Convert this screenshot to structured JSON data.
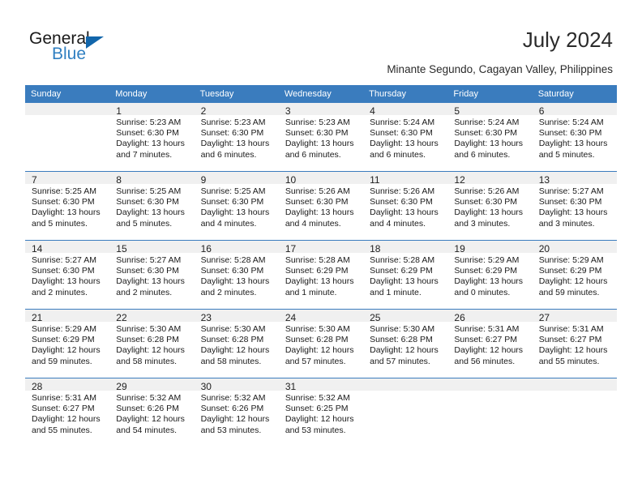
{
  "brand": {
    "name_primary": "General",
    "name_secondary": "Blue",
    "triangle_icon": "triangle-icon",
    "accent_color": "#1266ab",
    "secondary_color": "#2f7fc1"
  },
  "header": {
    "title": "July 2024",
    "subtitle": "Minante Segundo, Cagayan Valley, Philippines"
  },
  "table": {
    "header_bg": "#3a7cbe",
    "daynum_bg": "#f0f0f0",
    "columns": [
      "Sunday",
      "Monday",
      "Tuesday",
      "Wednesday",
      "Thursday",
      "Friday",
      "Saturday"
    ]
  },
  "weeks": [
    [
      {
        "day": "",
        "lines": []
      },
      {
        "day": "1",
        "lines": [
          "Sunrise: 5:23 AM",
          "Sunset: 6:30 PM",
          "Daylight: 13 hours",
          "and 7 minutes."
        ]
      },
      {
        "day": "2",
        "lines": [
          "Sunrise: 5:23 AM",
          "Sunset: 6:30 PM",
          "Daylight: 13 hours",
          "and 6 minutes."
        ]
      },
      {
        "day": "3",
        "lines": [
          "Sunrise: 5:23 AM",
          "Sunset: 6:30 PM",
          "Daylight: 13 hours",
          "and 6 minutes."
        ]
      },
      {
        "day": "4",
        "lines": [
          "Sunrise: 5:24 AM",
          "Sunset: 6:30 PM",
          "Daylight: 13 hours",
          "and 6 minutes."
        ]
      },
      {
        "day": "5",
        "lines": [
          "Sunrise: 5:24 AM",
          "Sunset: 6:30 PM",
          "Daylight: 13 hours",
          "and 6 minutes."
        ]
      },
      {
        "day": "6",
        "lines": [
          "Sunrise: 5:24 AM",
          "Sunset: 6:30 PM",
          "Daylight: 13 hours",
          "and 5 minutes."
        ]
      }
    ],
    [
      {
        "day": "7",
        "lines": [
          "Sunrise: 5:25 AM",
          "Sunset: 6:30 PM",
          "Daylight: 13 hours",
          "and 5 minutes."
        ]
      },
      {
        "day": "8",
        "lines": [
          "Sunrise: 5:25 AM",
          "Sunset: 6:30 PM",
          "Daylight: 13 hours",
          "and 5 minutes."
        ]
      },
      {
        "day": "9",
        "lines": [
          "Sunrise: 5:25 AM",
          "Sunset: 6:30 PM",
          "Daylight: 13 hours",
          "and 4 minutes."
        ]
      },
      {
        "day": "10",
        "lines": [
          "Sunrise: 5:26 AM",
          "Sunset: 6:30 PM",
          "Daylight: 13 hours",
          "and 4 minutes."
        ]
      },
      {
        "day": "11",
        "lines": [
          "Sunrise: 5:26 AM",
          "Sunset: 6:30 PM",
          "Daylight: 13 hours",
          "and 4 minutes."
        ]
      },
      {
        "day": "12",
        "lines": [
          "Sunrise: 5:26 AM",
          "Sunset: 6:30 PM",
          "Daylight: 13 hours",
          "and 3 minutes."
        ]
      },
      {
        "day": "13",
        "lines": [
          "Sunrise: 5:27 AM",
          "Sunset: 6:30 PM",
          "Daylight: 13 hours",
          "and 3 minutes."
        ]
      }
    ],
    [
      {
        "day": "14",
        "lines": [
          "Sunrise: 5:27 AM",
          "Sunset: 6:30 PM",
          "Daylight: 13 hours",
          "and 2 minutes."
        ]
      },
      {
        "day": "15",
        "lines": [
          "Sunrise: 5:27 AM",
          "Sunset: 6:30 PM",
          "Daylight: 13 hours",
          "and 2 minutes."
        ]
      },
      {
        "day": "16",
        "lines": [
          "Sunrise: 5:28 AM",
          "Sunset: 6:30 PM",
          "Daylight: 13 hours",
          "and 2 minutes."
        ]
      },
      {
        "day": "17",
        "lines": [
          "Sunrise: 5:28 AM",
          "Sunset: 6:29 PM",
          "Daylight: 13 hours",
          "and 1 minute."
        ]
      },
      {
        "day": "18",
        "lines": [
          "Sunrise: 5:28 AM",
          "Sunset: 6:29 PM",
          "Daylight: 13 hours",
          "and 1 minute."
        ]
      },
      {
        "day": "19",
        "lines": [
          "Sunrise: 5:29 AM",
          "Sunset: 6:29 PM",
          "Daylight: 13 hours",
          "and 0 minutes."
        ]
      },
      {
        "day": "20",
        "lines": [
          "Sunrise: 5:29 AM",
          "Sunset: 6:29 PM",
          "Daylight: 12 hours",
          "and 59 minutes."
        ]
      }
    ],
    [
      {
        "day": "21",
        "lines": [
          "Sunrise: 5:29 AM",
          "Sunset: 6:29 PM",
          "Daylight: 12 hours",
          "and 59 minutes."
        ]
      },
      {
        "day": "22",
        "lines": [
          "Sunrise: 5:30 AM",
          "Sunset: 6:28 PM",
          "Daylight: 12 hours",
          "and 58 minutes."
        ]
      },
      {
        "day": "23",
        "lines": [
          "Sunrise: 5:30 AM",
          "Sunset: 6:28 PM",
          "Daylight: 12 hours",
          "and 58 minutes."
        ]
      },
      {
        "day": "24",
        "lines": [
          "Sunrise: 5:30 AM",
          "Sunset: 6:28 PM",
          "Daylight: 12 hours",
          "and 57 minutes."
        ]
      },
      {
        "day": "25",
        "lines": [
          "Sunrise: 5:30 AM",
          "Sunset: 6:28 PM",
          "Daylight: 12 hours",
          "and 57 minutes."
        ]
      },
      {
        "day": "26",
        "lines": [
          "Sunrise: 5:31 AM",
          "Sunset: 6:27 PM",
          "Daylight: 12 hours",
          "and 56 minutes."
        ]
      },
      {
        "day": "27",
        "lines": [
          "Sunrise: 5:31 AM",
          "Sunset: 6:27 PM",
          "Daylight: 12 hours",
          "and 55 minutes."
        ]
      }
    ],
    [
      {
        "day": "28",
        "lines": [
          "Sunrise: 5:31 AM",
          "Sunset: 6:27 PM",
          "Daylight: 12 hours",
          "and 55 minutes."
        ]
      },
      {
        "day": "29",
        "lines": [
          "Sunrise: 5:32 AM",
          "Sunset: 6:26 PM",
          "Daylight: 12 hours",
          "and 54 minutes."
        ]
      },
      {
        "day": "30",
        "lines": [
          "Sunrise: 5:32 AM",
          "Sunset: 6:26 PM",
          "Daylight: 12 hours",
          "and 53 minutes."
        ]
      },
      {
        "day": "31",
        "lines": [
          "Sunrise: 5:32 AM",
          "Sunset: 6:25 PM",
          "Daylight: 12 hours",
          "and 53 minutes."
        ]
      },
      {
        "day": "",
        "lines": []
      },
      {
        "day": "",
        "lines": []
      },
      {
        "day": "",
        "lines": []
      }
    ]
  ]
}
